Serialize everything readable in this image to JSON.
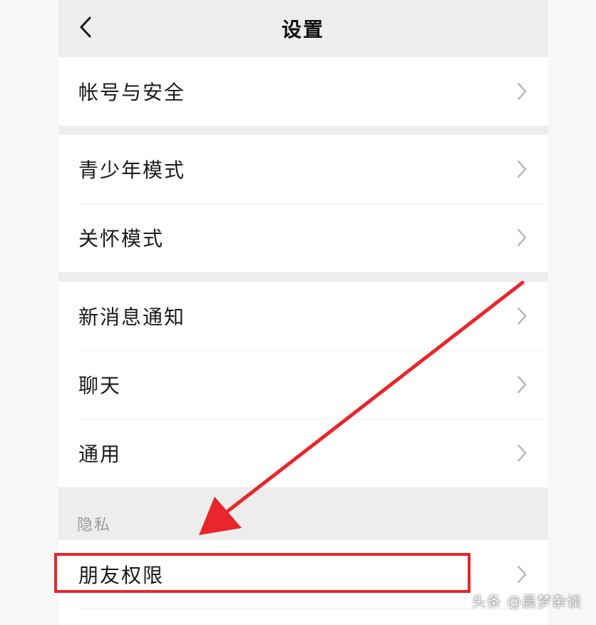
{
  "nav": {
    "title": "设置",
    "back_icon": "chevron-left-icon"
  },
  "groups": [
    {
      "items": [
        {
          "label": "帐号与安全"
        }
      ]
    },
    {
      "items": [
        {
          "label": "青少年模式"
        },
        {
          "label": "关怀模式"
        }
      ]
    },
    {
      "items": [
        {
          "label": "新消息通知"
        },
        {
          "label": "聊天"
        },
        {
          "label": "通用"
        }
      ]
    }
  ],
  "privacy": {
    "header": "隐私",
    "items": [
      {
        "label": "朋友权限"
      }
    ]
  },
  "annotation": {
    "highlight_color": "#e8262b",
    "arrow_color": "#e8262b"
  },
  "watermark": "头条 @晨梦杂谈",
  "colors": {
    "background": "#ededed",
    "cell": "#ffffff",
    "text": "#1a1a1a",
    "secondary_text": "#9a9a9a",
    "chevron": "#b2b2b2"
  }
}
